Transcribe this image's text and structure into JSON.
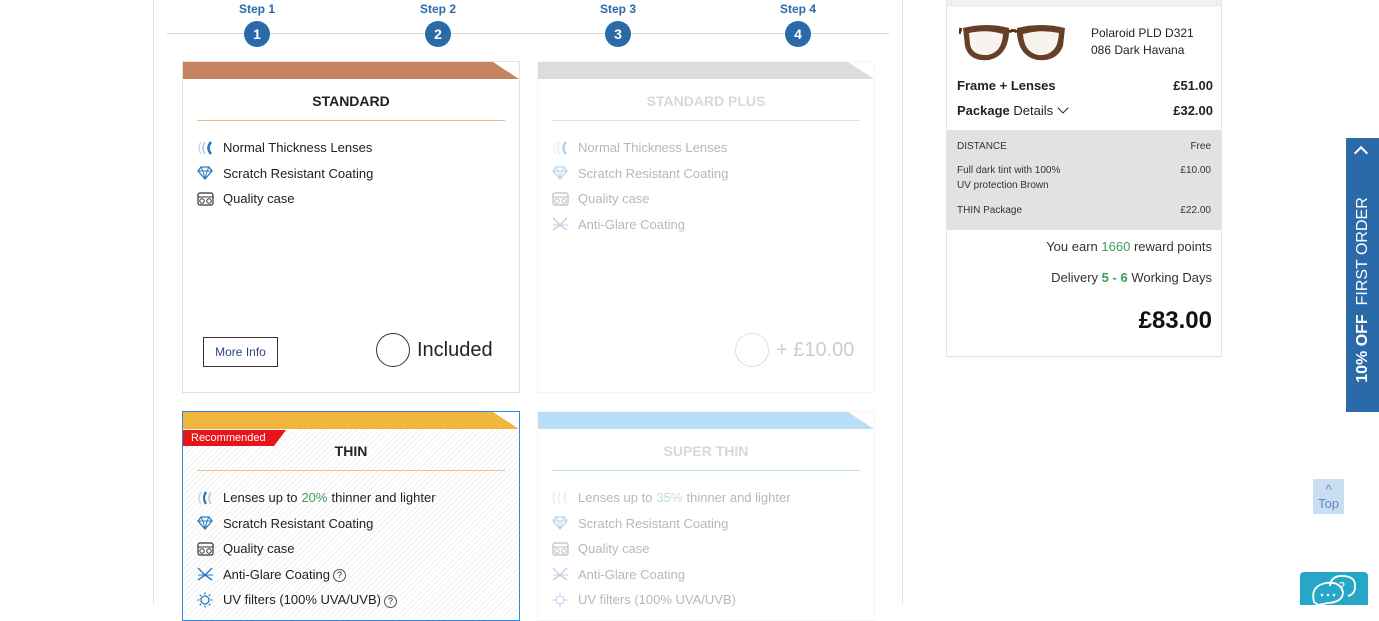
{
  "steps": [
    {
      "label": "Step 1",
      "num": "1"
    },
    {
      "label": "Step 2",
      "num": "2"
    },
    {
      "label": "Step 3",
      "num": "3"
    },
    {
      "label": "Step 4",
      "num": "4"
    }
  ],
  "packages": {
    "standard": {
      "title": "STANDARD",
      "features": [
        "Normal Thickness Lenses",
        "Scratch Resistant Coating",
        "Quality case"
      ],
      "more_info": "More Info",
      "price": "Included",
      "band_color": "#c5835f"
    },
    "standard_plus": {
      "title": "STANDARD PLUS",
      "features": [
        "Normal Thickness Lenses",
        "Scratch Resistant Coating",
        "Quality case",
        "Anti-Glare Coating"
      ],
      "price": "+ £10.00",
      "band_color": "#8f969b"
    },
    "thin": {
      "title": "THIN",
      "badge": "Recommended",
      "feature_lenses_pre": "Lenses up to",
      "feature_lenses_pct": "20%",
      "feature_lenses_post": "thinner and lighter",
      "features": [
        "Scratch Resistant Coating",
        "Quality case",
        "Anti-Glare Coating",
        "UV filters (100% UVA/UVB)"
      ],
      "help": "?",
      "band_color": "#f2b53e"
    },
    "super_thin": {
      "title": "SUPER THIN",
      "feature_lenses_pre": "Lenses up to",
      "feature_lenses_pct": "35%",
      "feature_lenses_post": "thinner and lighter",
      "features": [
        "Scratch Resistant Coating",
        "Quality case",
        "Anti-Glare Coating",
        "UV filters (100% UVA/UVB)"
      ],
      "band_color": "#2a9ae8"
    }
  },
  "summary": {
    "product_line1": "Polaroid PLD D321",
    "product_line2": "086 Dark Havana",
    "frame_lenses_label": "Frame + Lenses",
    "frame_lenses_price": "£51.00",
    "package_label": "Package",
    "package_details": "Details",
    "package_price": "£32.00",
    "extras": [
      {
        "name": "DISTANCE",
        "price": "Free"
      },
      {
        "name": "Full dark tint with 100%",
        "name2": "UV protection Brown",
        "price": "£10.00"
      },
      {
        "name": "THIN Package",
        "price": "£22.00"
      }
    ],
    "earn_pre": "You earn",
    "earn_points": "1660",
    "earn_post": "reward points",
    "delivery_pre": "Delivery",
    "delivery_days": "5 - 6",
    "delivery_post": "Working Days",
    "total": "£83.00"
  },
  "offer_tab": {
    "bold": "10% OFF",
    "text": "FIRST ORDER"
  },
  "top_button": {
    "arrow": "^",
    "label": "Top"
  },
  "icons": {
    "thickness": "lens-thickness-icon",
    "scratch": "diamond-icon",
    "case": "glasses-case-icon",
    "antiglare": "anti-glare-icon",
    "uv": "uv-filter-icon",
    "chat": "chat-help-icon"
  },
  "colors": {
    "accent": "#2a6aa8",
    "green": "#3a9f5a",
    "badge": "#e8141b"
  }
}
